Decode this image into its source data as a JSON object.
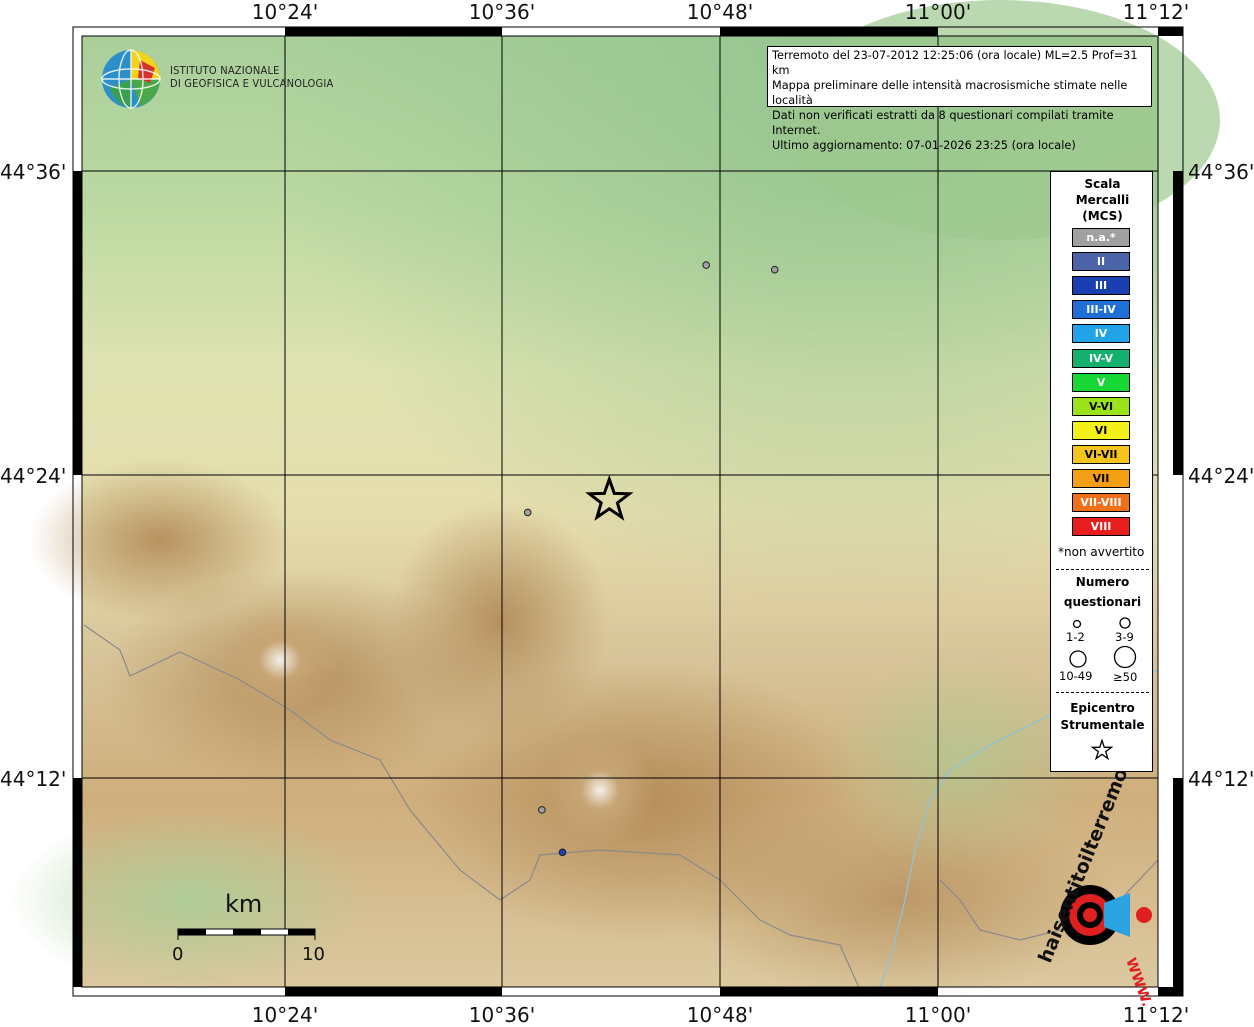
{
  "map": {
    "lon_labels": [
      "10°24'",
      "10°36'",
      "10°48'",
      "11°00'",
      "11°12'"
    ],
    "lat_labels": [
      "44°36'",
      "44°24'",
      "44°12'"
    ]
  },
  "info": {
    "line1": "Terremoto del 23-07-2012 12:25:06 (ora locale) ML=2.5 Prof=31 km",
    "line2": "Mappa preliminare delle intensità macrosismiche stimate nelle località",
    "line3": "Dati non verificati estratti da 8 questionari compilati tramite Internet.",
    "line4": "Ultimo aggiornamento: 07-01-2026 23:25 (ora locale)"
  },
  "logo": {
    "line1": "ISTITUTO NAZIONALE",
    "line2": "DI GEOFISICA E VULCANOLOGIA"
  },
  "legend": {
    "title_line1": "Scala",
    "title_line2": "Mercalli",
    "title_line3": "(MCS)",
    "items": [
      {
        "label": "n.a.*",
        "color": "#a0a0a0"
      },
      {
        "label": "II",
        "color": "#4b64a8"
      },
      {
        "label": "III",
        "color": "#1a3fb0"
      },
      {
        "label": "III-IV",
        "color": "#1f6fd6"
      },
      {
        "label": "IV",
        "color": "#20a3e8"
      },
      {
        "label": "IV-V",
        "color": "#14b06e"
      },
      {
        "label": "V",
        "color": "#17d835"
      },
      {
        "label": "V-VI",
        "color": "#9be41c"
      },
      {
        "label": "VI",
        "color": "#f3f01a"
      },
      {
        "label": "VI-VII",
        "color": "#f5c41d"
      },
      {
        "label": "VII",
        "color": "#f59f14"
      },
      {
        "label": "VII-VIII",
        "color": "#f07019"
      },
      {
        "label": "VIII",
        "color": "#e61e1e"
      }
    ],
    "note": "*non avvertito",
    "count_title_line1": "Numero",
    "count_title_line2": "questionari",
    "count_sizes": [
      "1-2",
      "3-9",
      "10-49",
      "≥50"
    ],
    "epicenter_line1": "Epicentro",
    "epicenter_line2": "Strumentale"
  },
  "scalebar": {
    "unit": "km",
    "start": "0",
    "end": "10"
  },
  "watermark": {
    "text_a": "haisentitoilterremoto.it",
    "text_b": "WWW."
  },
  "points": [
    {
      "name": "intensity-point-na",
      "lon_deg": 10.787,
      "lat_deg": 44.538,
      "intensity": "n.a.*"
    },
    {
      "name": "intensity-point-na",
      "lon_deg": 10.85,
      "lat_deg": 44.535,
      "intensity": "n.a.*"
    },
    {
      "name": "intensity-point-na",
      "lon_deg": 10.623,
      "lat_deg": 44.375,
      "intensity": "n.a.*"
    },
    {
      "name": "intensity-point-na",
      "lon_deg": 10.636,
      "lat_deg": 44.179,
      "intensity": "n.a.*"
    },
    {
      "name": "intensity-point-iii",
      "lon_deg": 10.655,
      "lat_deg": 44.151,
      "intensity": "III"
    }
  ],
  "epicenter": {
    "lon_deg": 10.698,
    "lat_deg": 44.383
  }
}
